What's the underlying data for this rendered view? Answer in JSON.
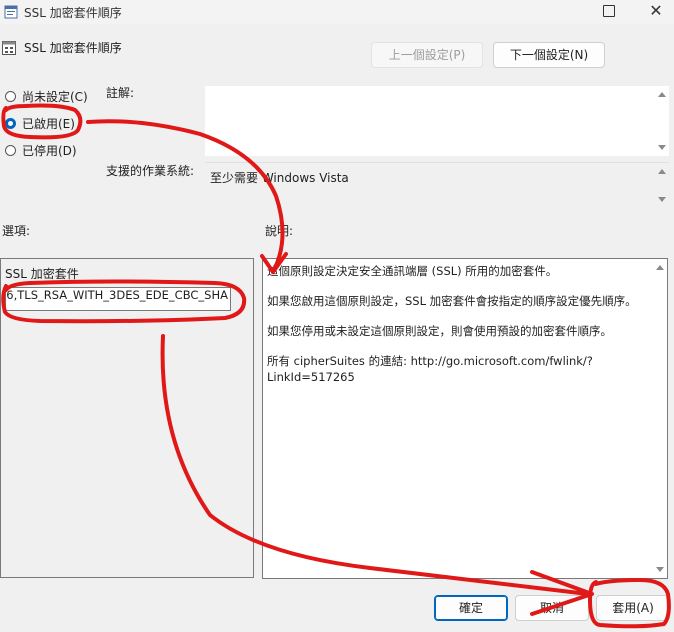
{
  "window": {
    "title": "SSL 加密套件順序",
    "maximize_icon": "maximize-icon",
    "close_icon": "close-icon"
  },
  "header": {
    "policy_name": "SSL 加密套件順序",
    "prev_button": "上一個設定(P)",
    "next_button": "下一個設定(N)"
  },
  "state": {
    "options": [
      {
        "label": "尚未設定(C)",
        "checked": false
      },
      {
        "label": "已啟用(E)",
        "checked": true
      },
      {
        "label": "已停用(D)",
        "checked": false
      }
    ]
  },
  "comment": {
    "label": "註解:",
    "value": ""
  },
  "supported": {
    "label": "支援的作業系統:",
    "value": "至少需要 Windows Vista"
  },
  "options_section": {
    "label": "選項:",
    "field_label": "SSL 加密套件",
    "field_value": "6,TLS_RSA_WITH_3DES_EDE_CBC_SHA"
  },
  "help_section": {
    "label": "說明:",
    "paragraphs": [
      "這個原則設定決定安全通訊端層 (SSL) 所用的加密套件。",
      "如果您啟用這個原則設定，SSL 加密套件會按指定的順序設定優先順序。",
      "如果您停用或未設定這個原則設定，則會使用預設的加密套件順序。",
      "所有 cipherSuites 的連結: http://go.microsoft.com/fwlink/?LinkId=517265"
    ]
  },
  "footer": {
    "ok_button": "確定",
    "cancel_button": "取消",
    "apply_button": "套用(A)"
  },
  "colors": {
    "accent": "#0067c0",
    "annotation": "#e01818"
  }
}
